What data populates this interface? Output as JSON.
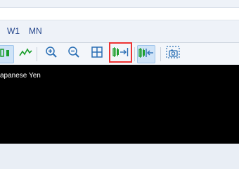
{
  "timeframes": [
    "W1",
    "MN"
  ],
  "toolbar": {
    "buttons": [
      "bar-chart-icon",
      "line-chart-icon",
      "zoom-in-icon",
      "zoom-out-icon",
      "grid-icon",
      "autoscroll-icon",
      "chart-shift-icon",
      "screenshot-icon"
    ]
  },
  "chart": {
    "title_fragment": "apanese Yen"
  },
  "colors": {
    "accent": "#1a9e2b",
    "highlight": "#e33333",
    "chart_bg": "#000000"
  }
}
